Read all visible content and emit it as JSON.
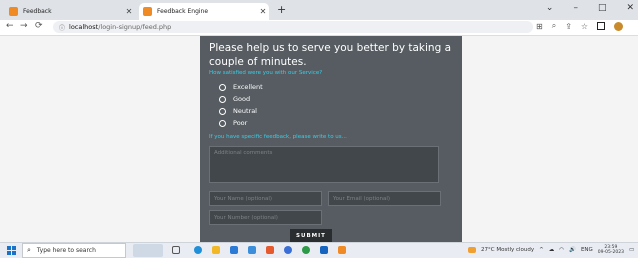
{
  "browser": {
    "tabs": [
      {
        "label": "Feedback",
        "close": "✕"
      },
      {
        "label": "Feedback Engine",
        "close": "✕"
      }
    ],
    "new_tab": "+",
    "controls": {
      "minimize": "⌄",
      "restore": "–",
      "maximize": "□",
      "close": "✕"
    },
    "nav": {
      "back": "←",
      "forward": "→",
      "reload": "⟳"
    },
    "url": {
      "host": "localhost",
      "path": "/login-signup/feed.php"
    }
  },
  "form": {
    "heading": "Please help us to serve you better by taking a couple of minutes.",
    "question1": "How satisfied were you with our Service?",
    "options": [
      "Excellent",
      "Good",
      "Neutral",
      "Poor"
    ],
    "question2": "If you have specific feedback, please write to us...",
    "comments_placeholder": "Additional comments",
    "first_name_placeholder": "Your Name (optional)",
    "email_placeholder": "Your Email (optional)",
    "number_placeholder": "Your Number (optional)",
    "submit_label": "SUBMIT"
  },
  "taskbar": {
    "search_placeholder": "Type here to search",
    "weather": "27°C  Mostly cloudy",
    "language": "ENG",
    "time": "23:59",
    "date": "09-05-2023"
  }
}
